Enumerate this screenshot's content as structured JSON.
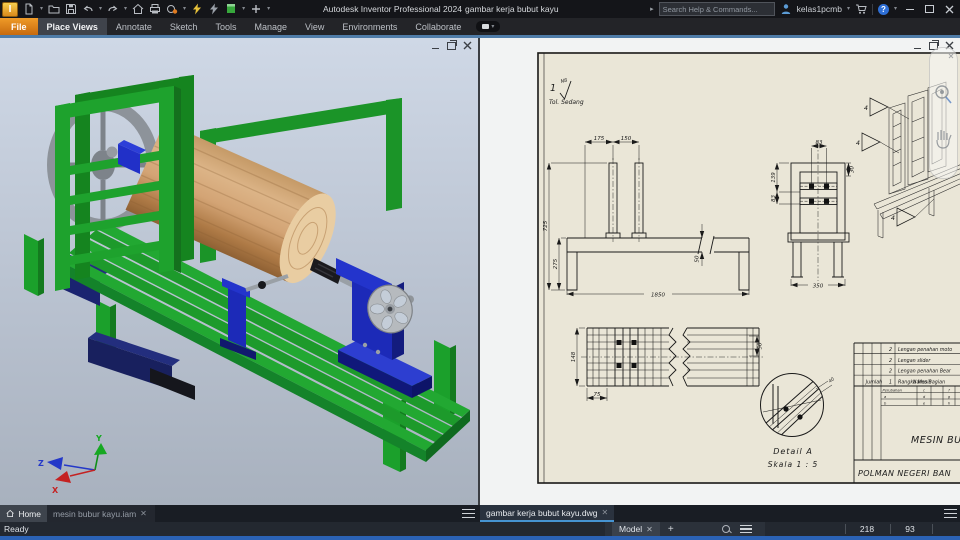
{
  "titlebar": {
    "app_title": "Autodesk Inventor Professional 2024",
    "doc_title": "gambar kerja bubut kayu",
    "search_placeholder": "Search Help & Commands...",
    "user_name": "kelas1pcmb",
    "toolbar_icons": [
      "inventor-logo",
      "new-file",
      "open",
      "save",
      "undo",
      "redo",
      "home",
      "print",
      "material",
      "ilogic-lightning",
      "rules-lightning",
      "green-box",
      "add",
      "overflow"
    ]
  },
  "ribbon": {
    "tabs": [
      {
        "label": "File"
      },
      {
        "label": "Place Views"
      },
      {
        "label": "Annotate"
      },
      {
        "label": "Sketch"
      },
      {
        "label": "Tools"
      },
      {
        "label": "Manage"
      },
      {
        "label": "View"
      },
      {
        "label": "Environments"
      },
      {
        "label": "Collaborate"
      }
    ],
    "active_tab": "Place Views"
  },
  "left_viewport": {
    "axis_x": "X",
    "axis_y": "Y",
    "axis_z": "Z"
  },
  "drawing": {
    "qty_note": "1",
    "surface_grade": "N8",
    "tolerance_note": "Tol. Sedang",
    "balloons": [
      "4",
      "4",
      "4"
    ],
    "dims": {
      "front_175": "175",
      "front_150": "150",
      "front_725": "725",
      "front_275": "275",
      "front_50": "50",
      "front_1850": "1850",
      "side_83_top": "83",
      "side_139": "139",
      "side_83_left": "83",
      "side_30": "30",
      "side_350": "350",
      "top_148": "148",
      "top_75": "75",
      "top_50": "50",
      "detail_40": "40"
    },
    "detail": {
      "label": "Detail A",
      "scale": "Skala 1 : 5"
    },
    "parts_list": {
      "rows": [
        {
          "qty": "2",
          "name": "Lengan penahan moto"
        },
        {
          "qty": "2",
          "name": "Lengan slider"
        },
        {
          "qty": "2",
          "name": "Lengan penahan Bear"
        },
        {
          "qty": "1",
          "name": "Rangka Mesin"
        }
      ],
      "qty_header": "Jumlah",
      "name_header": "Nama Bagian",
      "rev_label": "Perubahan",
      "rev_a": "a",
      "rev_b": "b",
      "rev_c": "c",
      "rev_d": "d",
      "rev_e": "e",
      "rev_f": "f",
      "rev_g": "g",
      "rev_h": "h",
      "title": "MESIN BU",
      "organization": "POLMAN NEGERI BAN"
    }
  },
  "doc_tabs": {
    "home_label": "Home",
    "assembly_tab": "mesin bubur kayu.iam",
    "drawing_tab": "gambar kerja bubut kayu.dwg"
  },
  "statusbar": {
    "status": "Ready",
    "model_tab": "Model",
    "count_1": "218",
    "count_2": "93"
  }
}
